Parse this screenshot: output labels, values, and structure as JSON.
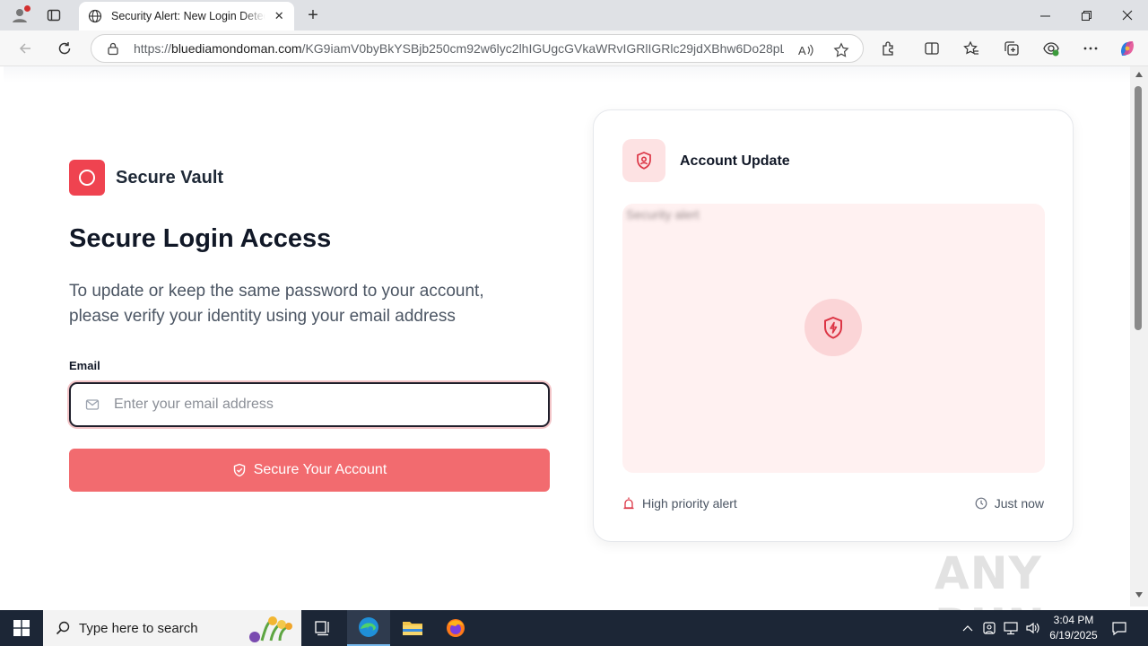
{
  "browser": {
    "tab_title": "Security Alert: New Login Detected",
    "url_host": "bluediamondoman.com",
    "url_prefix": "https://",
    "url_path": "/KG9iamV0byBkYSBjb250cm92w6lyc2lhIGUgcGVkaWRvIGRlIGRlc29jdXBhw6Do28pL..."
  },
  "page": {
    "brand_name": "Secure Vault",
    "title": "Secure Login Access",
    "subtitle": "To update or keep the same password to your account, please verify your identity using your email address",
    "email_label": "Email",
    "email_placeholder": "Enter your email address",
    "submit_label": "Secure Your Account",
    "accent_color": "#ef4350"
  },
  "card": {
    "title": "Account Update",
    "blurred_text": "Security alert",
    "footer_left": "High priority alert",
    "footer_right": "Just now"
  },
  "watermark": "ANY RUN",
  "taskbar": {
    "search_placeholder": "Type here to search",
    "time": "3:04 PM",
    "date": "6/19/2025"
  }
}
